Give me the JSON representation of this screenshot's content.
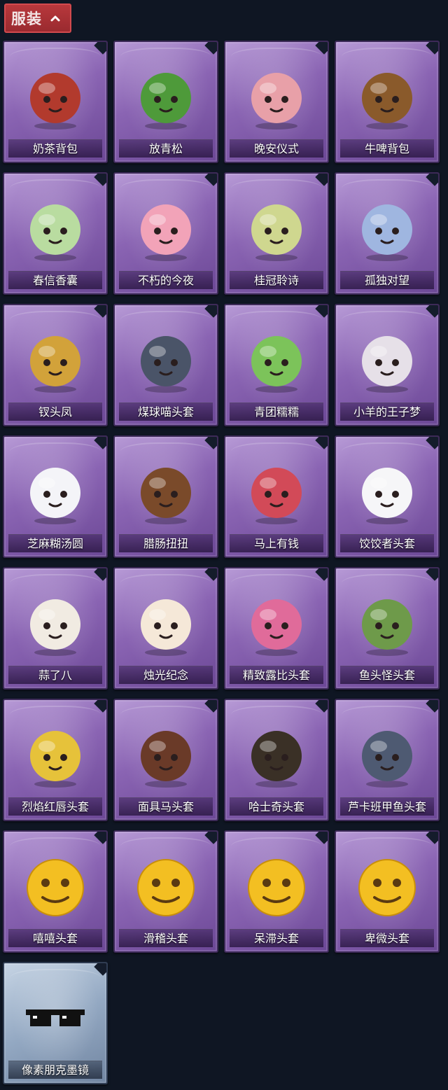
{
  "section": {
    "title": "服装",
    "toggle_icon": "chevron-up-icon"
  },
  "items": [
    {
      "name": "奶茶背包",
      "icon": "milk-tea-backpack-icon",
      "color": "#b23a2d"
    },
    {
      "name": "放青松",
      "icon": "pine-bonsai-icon",
      "color": "#4e9a3a"
    },
    {
      "name": "晚安仪式",
      "icon": "pig-figure-icon",
      "color": "#e8a0a8"
    },
    {
      "name": "牛啤背包",
      "icon": "cow-beer-barrel-icon",
      "color": "#8a5a2b"
    },
    {
      "name": "春信香囊",
      "icon": "sachet-icon",
      "color": "#b9dca0"
    },
    {
      "name": "不朽的今夜",
      "icon": "pink-fox-icon",
      "color": "#f2a3b8"
    },
    {
      "name": "桂冠聆诗",
      "icon": "laurel-charm-icon",
      "color": "#cfd78f"
    },
    {
      "name": "孤独对望",
      "icon": "blue-charm-icon",
      "color": "#9fb6e0"
    },
    {
      "name": "钗头凤",
      "icon": "phoenix-crown-icon",
      "color": "#d2a23a"
    },
    {
      "name": "煤球喵头套",
      "icon": "cat-head-icon",
      "color": "#4a5468"
    },
    {
      "name": "青团糯糯",
      "icon": "green-dumpling-icon",
      "color": "#7cc35a"
    },
    {
      "name": "小羊的王子梦",
      "icon": "sheep-crown-icon",
      "color": "#e6e0e8"
    },
    {
      "name": "芝麻糊汤圆",
      "icon": "rice-ball-icon",
      "color": "#f4f4f8"
    },
    {
      "name": "腊肠扭扭",
      "icon": "dachshund-head-icon",
      "color": "#7a4a2a"
    },
    {
      "name": "马上有钱",
      "icon": "red-horse-head-icon",
      "color": "#d24a58"
    },
    {
      "name": "饺饺者头套",
      "icon": "dumpling-head-icon",
      "color": "#f6f6f8"
    },
    {
      "name": "蒜了八",
      "icon": "garlic-head-icon",
      "color": "#f1ebe2"
    },
    {
      "name": "烛光纪念",
      "icon": "candle-head-icon",
      "color": "#f5e8d8"
    },
    {
      "name": "精致露比头套",
      "icon": "pink-beaver-head-icon",
      "color": "#e06b9a"
    },
    {
      "name": "鱼头怪头套",
      "icon": "fish-head-mask-icon",
      "color": "#6e9a4a"
    },
    {
      "name": "烈焰红唇头套",
      "icon": "yellow-mouse-head-icon",
      "color": "#e6c23a"
    },
    {
      "name": "面具马头套",
      "icon": "horse-mask-icon",
      "color": "#6a3a28"
    },
    {
      "name": "哈士奇头套",
      "icon": "husky-head-icon",
      "color": "#3a3026"
    },
    {
      "name": "芦卡班甲鱼头套",
      "icon": "turtle-head-icon",
      "color": "#4e5a72"
    },
    {
      "name": "嘻嘻头套",
      "icon": "grin-emoji-head-icon",
      "color": "#f3bf22"
    },
    {
      "name": "滑稽头套",
      "icon": "smirk-emoji-head-icon",
      "color": "#f3bf22"
    },
    {
      "name": "呆滞头套",
      "icon": "dazed-emoji-head-icon",
      "color": "#f3bf22"
    },
    {
      "name": "卑微头套",
      "icon": "meek-emoji-head-icon",
      "color": "#f3bf22"
    },
    {
      "name": "像素朋克墨镜",
      "icon": "pixel-sunglasses-icon",
      "color": "#111111",
      "rarity": "blue"
    }
  ]
}
